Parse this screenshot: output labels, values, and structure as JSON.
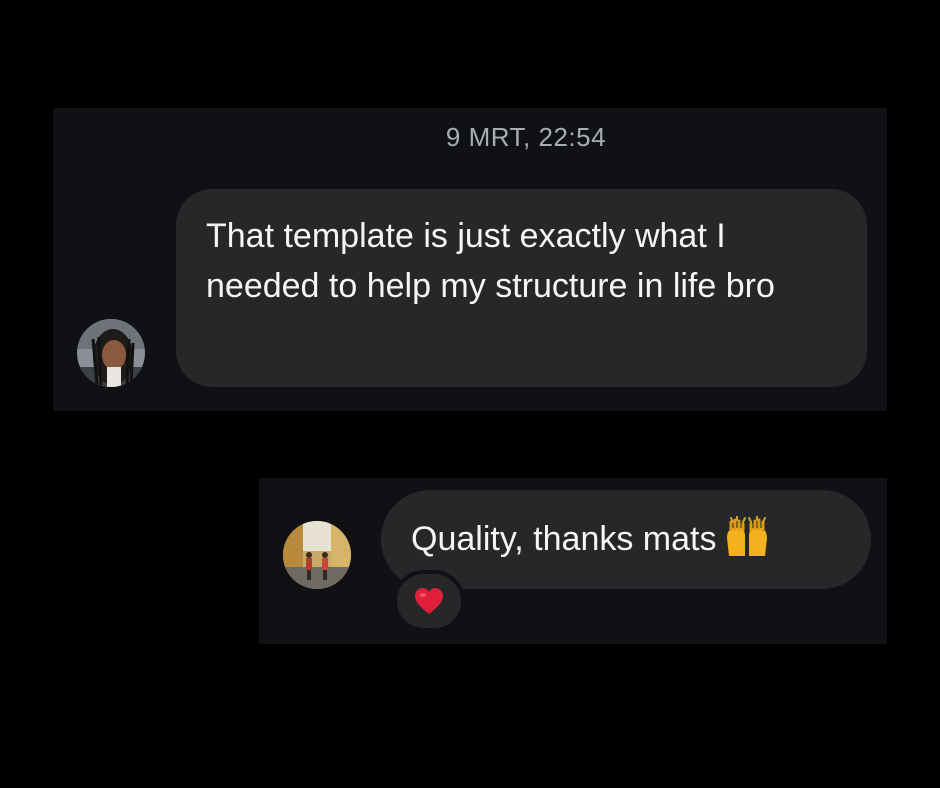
{
  "thread": {
    "timestamp": "9 MRT, 22:54",
    "messages": [
      {
        "text": "That template is just exactly what I needed to help my structure in life bro",
        "direction": "incoming",
        "avatar": "avatar-person-dreadlocks"
      },
      {
        "text": "Quality, thanks mats",
        "emoji": "raising-hands-emoji",
        "direction": "incoming",
        "avatar": "avatar-street-photo",
        "reaction": {
          "symbol": "❤️",
          "icon": "red-heart-icon"
        }
      }
    ]
  },
  "colors": {
    "background": "#000000",
    "panel": "#0f1114",
    "bubble": "#262729",
    "text": "#f5f5f5",
    "timestamp": "#a8acb3",
    "heart": "#e0203a"
  }
}
